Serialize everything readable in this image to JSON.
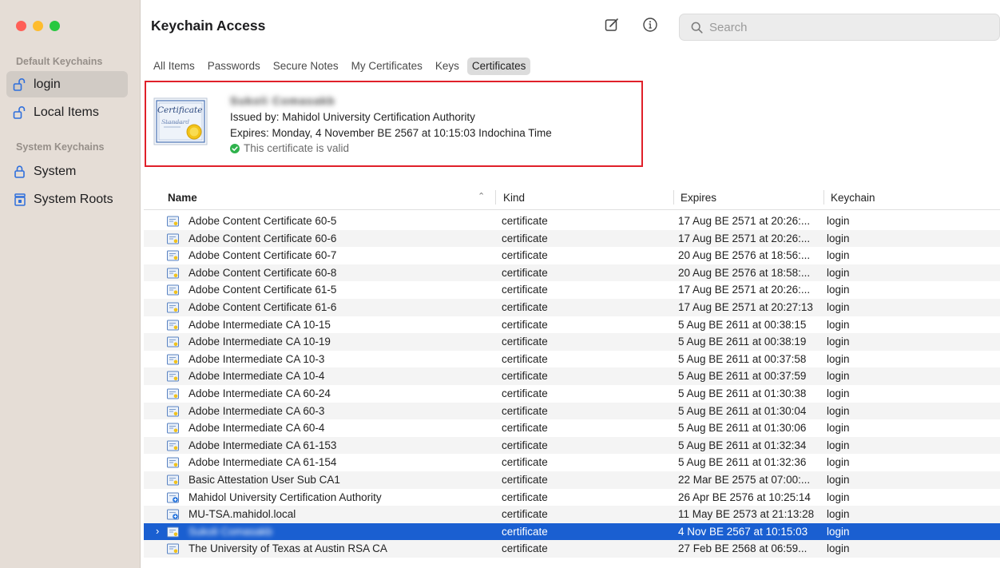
{
  "window": {
    "title": "Keychain Access",
    "traffic_lights": {
      "close": "#ff5f57",
      "minimize": "#febc2e",
      "zoom": "#28c840"
    }
  },
  "sidebar": {
    "default_section": "Default Keychains",
    "system_section": "System Keychains",
    "items": [
      {
        "label": "login",
        "icon": "unlocked-padlock-icon",
        "selected": true
      },
      {
        "label": "Local Items",
        "icon": "unlocked-padlock-icon",
        "selected": false
      },
      {
        "label": "System",
        "icon": "locked-padlock-icon",
        "selected": false
      },
      {
        "label": "System Roots",
        "icon": "cabinet-lock-icon",
        "selected": false
      }
    ]
  },
  "toolbar": {
    "new_icon": "compose-icon",
    "info_icon": "info-icon",
    "search_placeholder": "Search"
  },
  "tabs": [
    {
      "label": "All Items",
      "active": false
    },
    {
      "label": "Passwords",
      "active": false
    },
    {
      "label": "Secure Notes",
      "active": false
    },
    {
      "label": "My Certificates",
      "active": false
    },
    {
      "label": "Keys",
      "active": false
    },
    {
      "label": "Certificates",
      "active": true
    }
  ],
  "preview": {
    "name": "Sukoli Comasakb",
    "issued_by": "Issued by: Mahidol University Certification Authority",
    "expires": "Expires: Monday, 4 November BE 2567 at 10:15:03 Indochina Time",
    "status": "This certificate is valid",
    "thumb_text_1": "Certificate",
    "thumb_text_2": "Standard",
    "accent": "#e0202a",
    "valid_color": "#2fb24c"
  },
  "table": {
    "columns": {
      "name": "Name",
      "kind": "Kind",
      "expires": "Expires",
      "keychain": "Keychain"
    },
    "rows": [
      {
        "name": "Adobe Content Certificate 60-5",
        "kind": "certificate",
        "expires": "17 Aug BE 2571 at 20:26:...",
        "keychain": "login"
      },
      {
        "name": "Adobe Content Certificate 60-6",
        "kind": "certificate",
        "expires": "17 Aug BE 2571 at 20:26:...",
        "keychain": "login"
      },
      {
        "name": "Adobe Content Certificate 60-7",
        "kind": "certificate",
        "expires": "20 Aug BE 2576 at 18:56:...",
        "keychain": "login"
      },
      {
        "name": "Adobe Content Certificate 60-8",
        "kind": "certificate",
        "expires": "20 Aug BE 2576 at 18:58:...",
        "keychain": "login"
      },
      {
        "name": "Adobe Content Certificate 61-5",
        "kind": "certificate",
        "expires": "17 Aug BE 2571 at 20:26:...",
        "keychain": "login"
      },
      {
        "name": "Adobe Content Certificate 61-6",
        "kind": "certificate",
        "expires": "17 Aug BE 2571 at 20:27:13",
        "keychain": "login"
      },
      {
        "name": "Adobe Intermediate CA 10-15",
        "kind": "certificate",
        "expires": "5 Aug BE 2611 at 00:38:15",
        "keychain": "login"
      },
      {
        "name": "Adobe Intermediate CA 10-19",
        "kind": "certificate",
        "expires": "5 Aug BE 2611 at 00:38:19",
        "keychain": "login"
      },
      {
        "name": "Adobe Intermediate CA 10-3",
        "kind": "certificate",
        "expires": "5 Aug BE 2611 at 00:37:58",
        "keychain": "login"
      },
      {
        "name": "Adobe Intermediate CA 10-4",
        "kind": "certificate",
        "expires": "5 Aug BE 2611 at 00:37:59",
        "keychain": "login"
      },
      {
        "name": "Adobe Intermediate CA 60-24",
        "kind": "certificate",
        "expires": "5 Aug BE 2611 at 01:30:38",
        "keychain": "login"
      },
      {
        "name": "Adobe Intermediate CA 60-3",
        "kind": "certificate",
        "expires": "5 Aug BE 2611 at 01:30:04",
        "keychain": "login"
      },
      {
        "name": "Adobe Intermediate CA 60-4",
        "kind": "certificate",
        "expires": "5 Aug BE 2611 at 01:30:06",
        "keychain": "login"
      },
      {
        "name": "Adobe Intermediate CA 61-153",
        "kind": "certificate",
        "expires": "5 Aug BE 2611 at 01:32:34",
        "keychain": "login"
      },
      {
        "name": "Adobe Intermediate CA 61-154",
        "kind": "certificate",
        "expires": "5 Aug BE 2611 at 01:32:36",
        "keychain": "login"
      },
      {
        "name": "Basic Attestation User Sub CA1",
        "kind": "certificate",
        "expires": "22 Mar BE 2575 at 07:00:...",
        "keychain": "login"
      },
      {
        "name": "Mahidol University Certification Authority",
        "kind": "certificate",
        "expires": "26 Apr BE 2576 at 10:25:14",
        "keychain": "login",
        "root": true
      },
      {
        "name": "MU-TSA.mahidol.local",
        "kind": "certificate",
        "expires": "11 May BE 2573 at 21:13:28",
        "keychain": "login",
        "root": true
      },
      {
        "name": "Sukoli Comasakb",
        "kind": "certificate",
        "expires": "4 Nov BE 2567 at 10:15:03",
        "keychain": "login",
        "selected": true,
        "blurred": true,
        "expandable": true
      },
      {
        "name": "The University of Texas at Austin RSA CA",
        "kind": "certificate",
        "expires": "27 Feb BE 2568 at 06:59...",
        "keychain": "login"
      }
    ],
    "selection_color": "#1a5fd1"
  }
}
